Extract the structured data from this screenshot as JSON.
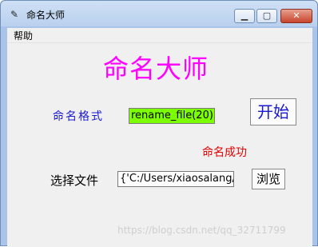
{
  "window": {
    "title": "命名大师"
  },
  "menu": {
    "help": "帮助"
  },
  "main": {
    "heading": "命名大师",
    "format_label": "命名格式",
    "format_value": "rename_file(20)",
    "start_button": "开始",
    "status": "命名成功",
    "file_label": "选择文件",
    "file_value": "{'C:/Users/xiaosalang/De",
    "browse_button": "浏览"
  },
  "watermark": "https://blog.csdn.net/qq_32711799",
  "colors": {
    "heading": "#ff00ff",
    "format_label": "#1919d2",
    "start_button": "#1919d2",
    "status": "#e00000",
    "format_field_bg": "#7cff00"
  },
  "icons": {
    "app": "feather-icon",
    "minimize": "minimize-icon",
    "maximize": "maximize-icon",
    "close": "close-icon"
  }
}
